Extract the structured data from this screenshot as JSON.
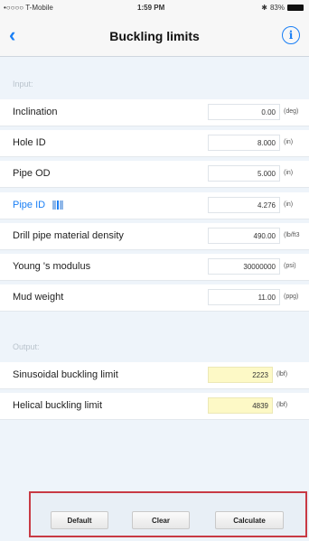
{
  "status_bar": {
    "carrier": "•○○○○ T-Mobile",
    "time": "1:59 PM",
    "battery": "83%"
  },
  "nav": {
    "back_glyph": "‹",
    "title": "Buckling limits",
    "info_glyph": "i"
  },
  "input_section": {
    "label": "Input:",
    "rows": [
      {
        "label": "Inclination",
        "value": "0.00",
        "unit": "(deg)"
      },
      {
        "label": "Hole ID",
        "value": "8.000",
        "unit": "(in)"
      },
      {
        "label": "Pipe OD",
        "value": "5.000",
        "unit": "(in)"
      },
      {
        "label": "Pipe ID",
        "value": "4.276",
        "unit": "(in)"
      },
      {
        "label": "Drill pipe material density",
        "value": "490.00",
        "unit": "(lb/ft3"
      },
      {
        "label": "Young 's modulus",
        "value": "30000000",
        "unit": "(psi)"
      },
      {
        "label": "Mud weight",
        "value": "11.00",
        "unit": "(ppg)"
      }
    ]
  },
  "output_section": {
    "label": "Output:",
    "rows": [
      {
        "label": "Sinusoidal buckling limit",
        "value": "2223",
        "unit": "(lbf)"
      },
      {
        "label": "Helical buckling limit",
        "value": "4839",
        "unit": "(lbf)"
      }
    ]
  },
  "toolbar": {
    "default_label": "Default",
    "clear_label": "Clear",
    "calculate_label": "Calculate"
  },
  "colors": {
    "accent": "#1a7ff5",
    "output_bg": "#fdf9c6",
    "highlight_border": "#c83a44"
  }
}
